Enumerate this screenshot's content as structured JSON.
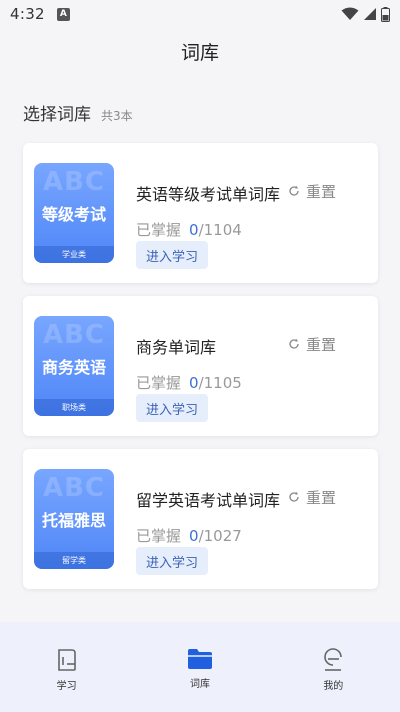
{
  "status_bar": {
    "time": "4:32",
    "notification_letter": "A",
    "icons": [
      "wifi-icon",
      "signal-icon",
      "battery-icon"
    ]
  },
  "header": {
    "title": "词库"
  },
  "section": {
    "title": "选择词库",
    "count": "共3本"
  },
  "books": [
    {
      "cover_watermark": "ABC",
      "cover_name": "等级考试",
      "cover_category": "学业类",
      "name": "英语等级考试单词库",
      "reset_label": "重置",
      "progress_label": "已掌握",
      "mastered": "0",
      "total": "/1104",
      "study_label": "进入学习"
    },
    {
      "cover_watermark": "ABC",
      "cover_name": "商务英语",
      "cover_category": "职场类",
      "name": "商务单词库",
      "reset_label": "重置",
      "progress_label": "已掌握",
      "mastered": "0",
      "total": "/1105",
      "study_label": "进入学习"
    },
    {
      "cover_watermark": "ABC",
      "cover_name": "托福雅思",
      "cover_category": "留学类",
      "name": "留学英语考试单词库",
      "reset_label": "重置",
      "progress_label": "已掌握",
      "mastered": "0",
      "total": "/1027",
      "study_label": "进入学习"
    }
  ],
  "bottom_nav": {
    "items": [
      {
        "label": "学习",
        "icon": "book-icon",
        "active": false
      },
      {
        "label": "词库",
        "icon": "folder-icon",
        "active": true
      },
      {
        "label": "我的",
        "icon": "profile-icon",
        "active": false
      }
    ]
  },
  "colors": {
    "accent": "#3e6fd8",
    "cover_gradient_top": "#78a6ff",
    "cover_gradient_bottom": "#4f86f7",
    "nav_background": "#eef0fb",
    "active_nav_icon": "#1f5fe0"
  }
}
